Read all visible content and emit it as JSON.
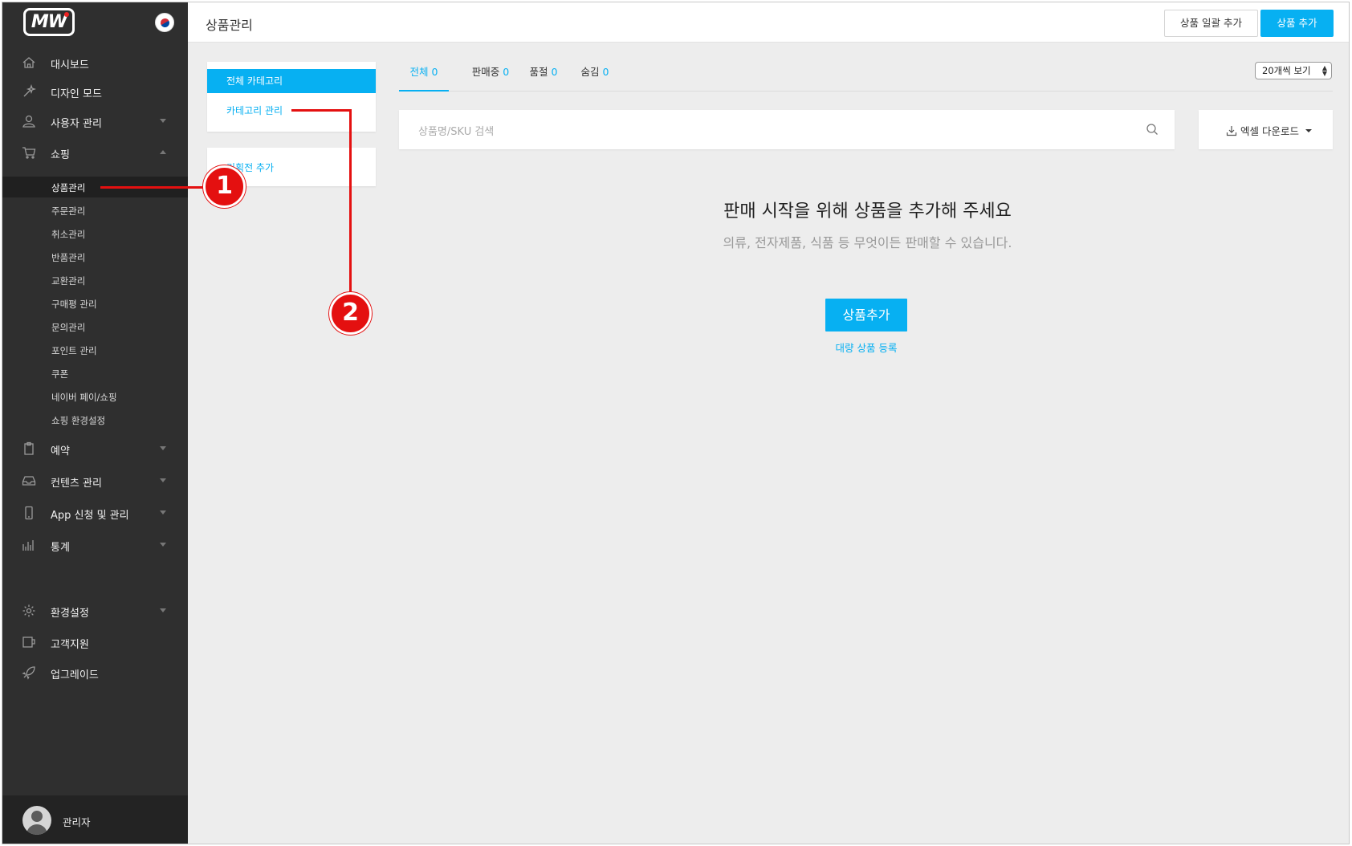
{
  "brand": {
    "logo_text": "MW",
    "language_flag": "korea-flag-icon"
  },
  "sidebar": {
    "items": [
      {
        "label": "대시보드",
        "icon": "home-icon"
      },
      {
        "label": "디자인 모드",
        "icon": "magic-wand-icon"
      },
      {
        "label": "사용자 관리",
        "icon": "user-icon"
      },
      {
        "label": "쇼핑",
        "icon": "cart-icon"
      },
      {
        "label": "예약",
        "icon": "clipboard-icon"
      },
      {
        "label": "컨텐츠 관리",
        "icon": "inbox-icon"
      },
      {
        "label": "App 신청 및 관리",
        "icon": "mobile-icon"
      },
      {
        "label": "통계",
        "icon": "bar-chart-icon"
      },
      {
        "label": "환경설정",
        "icon": "gear-icon"
      },
      {
        "label": "고객지원",
        "icon": "cup-icon"
      },
      {
        "label": "업그레이드",
        "icon": "rocket-icon"
      }
    ],
    "shopping_sub": [
      "상품관리",
      "주문관리",
      "취소관리",
      "반품관리",
      "교환관리",
      "구매평 관리",
      "문의관리",
      "포인트 관리",
      "쿠폰",
      "네이버 페이/쇼핑",
      "쇼핑 환경설정"
    ],
    "active_sub": "상품관리",
    "user_label": "관리자"
  },
  "header": {
    "title": "상품관리",
    "bulk_add_label": "상품 일괄 추가",
    "add_label": "상품 추가"
  },
  "categories": {
    "all_label": "전체 카테고리",
    "manage_label": "카테고리 관리",
    "promo_label": "기획전 추가"
  },
  "tabs": [
    {
      "label": "전체",
      "count": "0"
    },
    {
      "label": "판매중",
      "count": "0"
    },
    {
      "label": "품절",
      "count": "0"
    },
    {
      "label": "숨김",
      "count": "0"
    }
  ],
  "per_page": "20개씩 보기",
  "search": {
    "placeholder": "상품명/SKU 검색"
  },
  "excel_label": "엑셀 다운로드",
  "empty_state": {
    "title": "판매 시작을 위해 상품을 추가해 주세요",
    "subtitle": "의류, 전자제품, 식품 등 무엇이든 판매할 수 있습니다.",
    "add_label": "상품추가",
    "bulk_label": "대량 상품 등록"
  },
  "callouts": [
    "1",
    "2"
  ],
  "colors": {
    "accent": "#07b0f2",
    "sidebar": "#2f2f2f",
    "callout": "#e41010"
  }
}
